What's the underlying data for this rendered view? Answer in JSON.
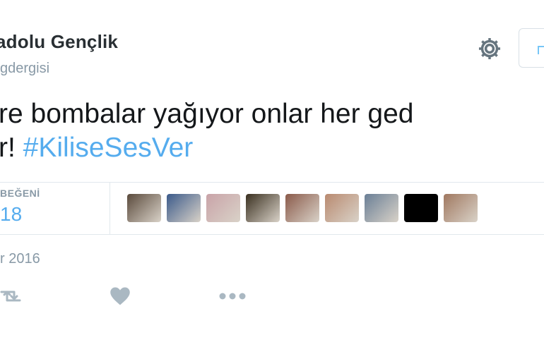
{
  "header": {
    "display_name": "adolu Gençlik",
    "handle": "gdergisi"
  },
  "tweet": {
    "line1": "re bombalar yağıyor onlar her ged",
    "line2_prefix": "r! ",
    "hashtag": "#KiliseSesVer"
  },
  "stats": {
    "likes_label": "BEĞENİ",
    "likes_count": "18"
  },
  "avatars": [
    {
      "name": "liker-avatar-1",
      "color": "#5a4a3c"
    },
    {
      "name": "liker-avatar-2",
      "color": "#3b5a8a"
    },
    {
      "name": "liker-avatar-3",
      "color": "#c9a3a8"
    },
    {
      "name": "liker-avatar-4",
      "color": "#3a3020"
    },
    {
      "name": "liker-avatar-5",
      "color": "#8a5a4a"
    },
    {
      "name": "liker-avatar-6",
      "color": "#b98a70"
    },
    {
      "name": "liker-avatar-7",
      "color": "#6a7f96"
    },
    {
      "name": "liker-avatar-8",
      "color": "#000000"
    },
    {
      "name": "liker-avatar-9",
      "color": "#a07860"
    }
  ],
  "date": "r 2016",
  "colors": {
    "accent": "#55acee",
    "muted": "#8899a6",
    "icon": "#aab8c2",
    "text": "#14171a"
  },
  "icons": {
    "settings": "gear-icon",
    "retweet": "retweet-icon",
    "like": "heart-icon",
    "more": "more-icon"
  }
}
